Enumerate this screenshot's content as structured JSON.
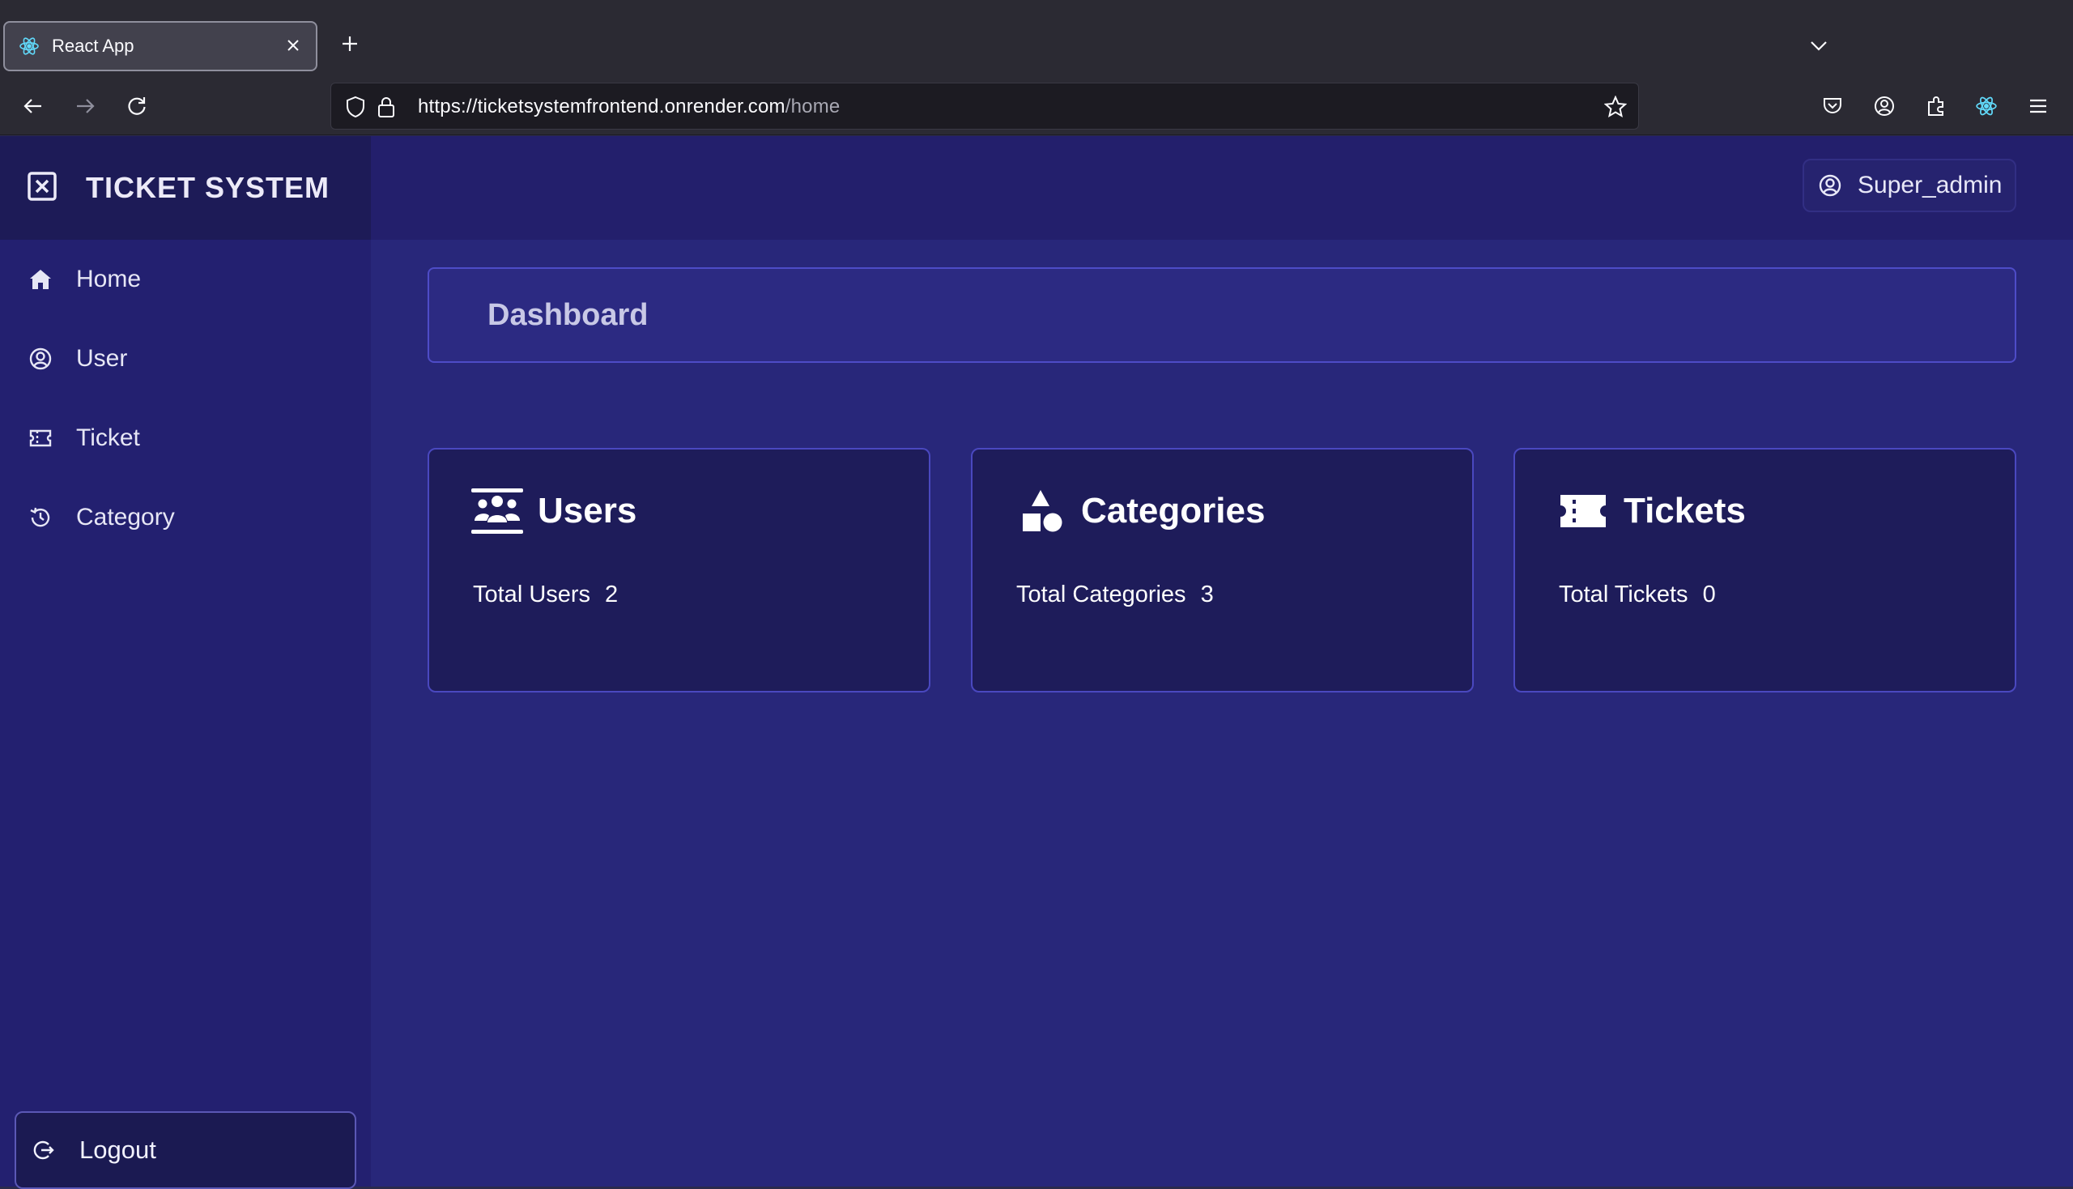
{
  "browser": {
    "tab_title": "React App",
    "url_main": "https://ticketsystemfrontend.onrender.com",
    "url_path": "/home"
  },
  "app": {
    "brand": "TICKET SYSTEM",
    "user": "Super_admin",
    "sidebar": {
      "items": [
        {
          "label": "Home",
          "icon": "home-icon"
        },
        {
          "label": "User",
          "icon": "user-circle-icon"
        },
        {
          "label": "Ticket",
          "icon": "ticket-icon"
        },
        {
          "label": "Category",
          "icon": "history-icon"
        }
      ],
      "logout": "Logout"
    },
    "page_title": "Dashboard",
    "cards": [
      {
        "title": "Users",
        "stat_label": "Total Users",
        "stat_value": "2",
        "icon": "users-group-icon"
      },
      {
        "title": "Categories",
        "stat_label": "Total Categories",
        "stat_value": "3",
        "icon": "shapes-icon"
      },
      {
        "title": "Tickets",
        "stat_label": "Total Tickets",
        "stat_value": "0",
        "icon": "ticket-icon"
      }
    ]
  },
  "colors": {
    "sidebar": "#232070",
    "brand_bg": "#1d1b57",
    "content_bg": "#28277a",
    "card_bg": "#1e1c5a",
    "card_border": "#4a48bf",
    "browser_chrome": "#2b2a33"
  }
}
